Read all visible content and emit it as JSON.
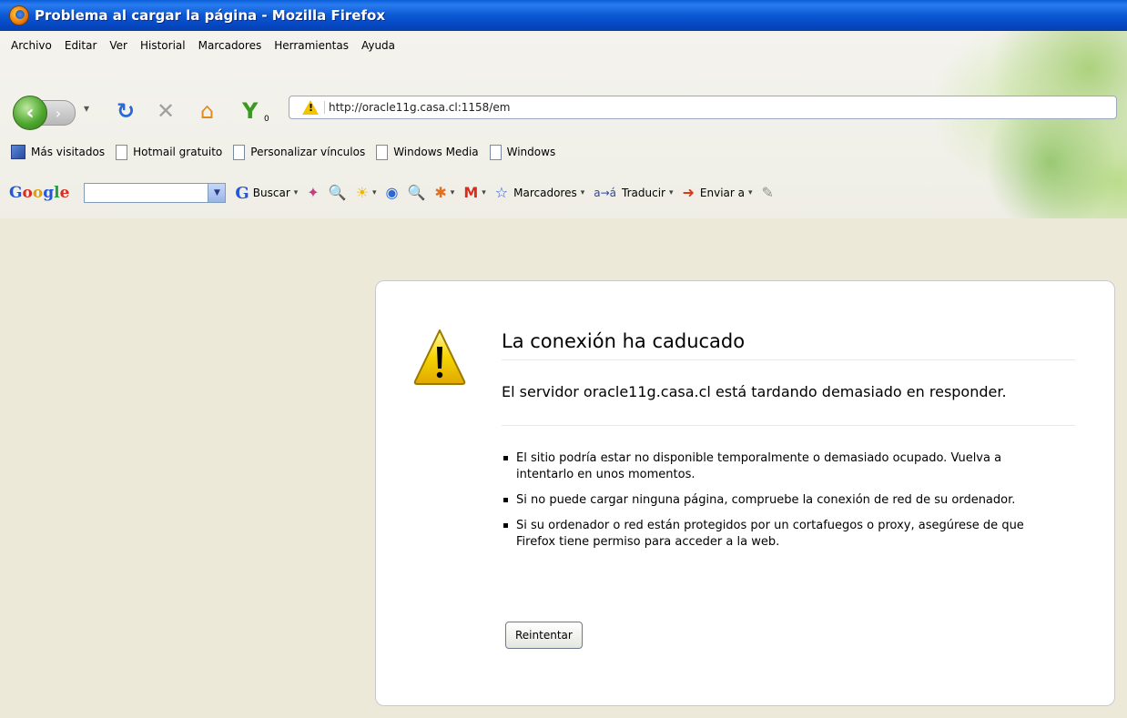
{
  "window": {
    "title": "Problema al cargar la página - Mozilla Firefox"
  },
  "menu": [
    "Archivo",
    "Editar",
    "Ver",
    "Historial",
    "Marcadores",
    "Herramientas",
    "Ayuda"
  ],
  "navbar": {
    "url": "http://oracle11g.casa.cl:1158/em",
    "badge": "0"
  },
  "bookmarks": [
    "Más visitados",
    "Hotmail gratuito",
    "Personalizar vínculos",
    "Windows Media",
    "Windows"
  ],
  "google_toolbar": {
    "logo": "Google",
    "search_label": "Buscar",
    "bookmarks_label": "Marcadores",
    "translate_label": "Traducir",
    "send_label": "Enviar a"
  },
  "error": {
    "title": "La conexión ha caducado",
    "subtitle": "El servidor oracle11g.casa.cl está tardando demasiado en responder.",
    "bullets": [
      "El sitio podría estar no disponible temporalmente o demasiado ocupado. Vuelva a intentarlo en unos momentos.",
      "Si no puede cargar ninguna página, compruebe la conexión de red de su ordenador.",
      "Si su ordenador o red están protegidos por un cortafuegos o proxy, asegúrese de que Firefox tiene permiso para acceder a la web."
    ],
    "retry_label": "Reintentar"
  },
  "colors": {
    "titlebar": "#0b58d2",
    "chrome": "#f4f3ee",
    "page_bg": "#ece9d8",
    "warning": "#f4c400"
  }
}
